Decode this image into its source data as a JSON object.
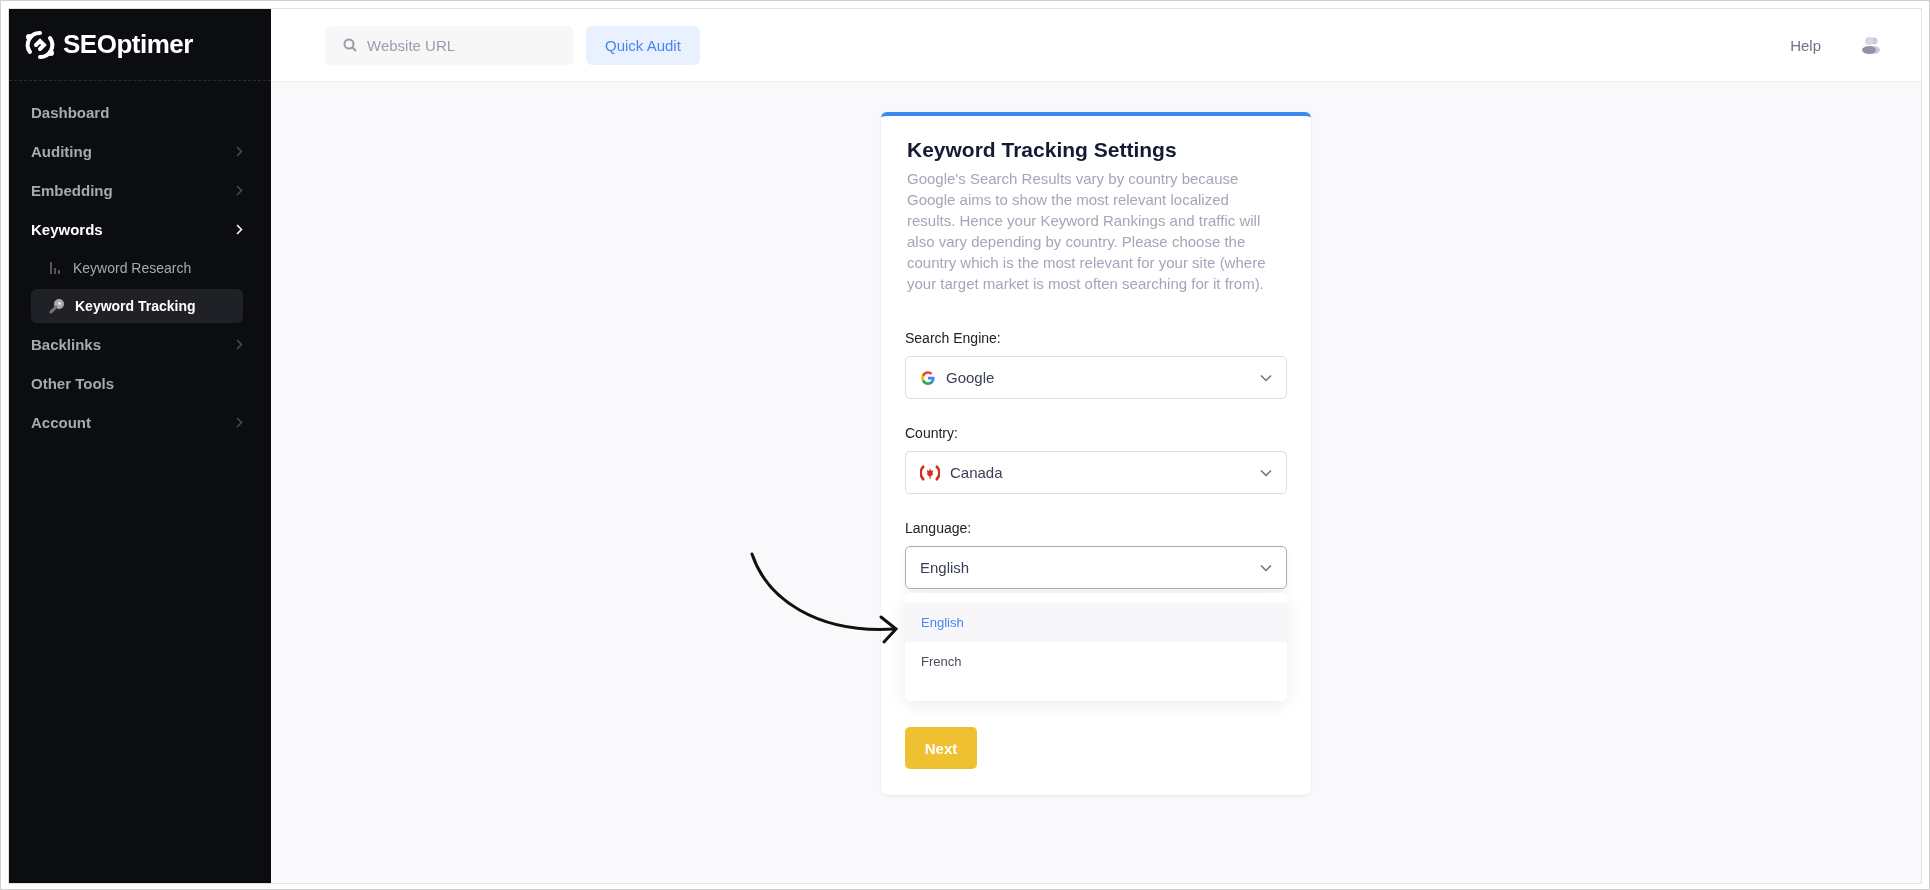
{
  "logo": {
    "text": "SEOptimer"
  },
  "sidebar": {
    "items": [
      {
        "label": "Dashboard",
        "expandable": false,
        "selected": false
      },
      {
        "label": "Auditing",
        "expandable": true,
        "selected": false
      },
      {
        "label": "Embedding",
        "expandable": true,
        "selected": false
      },
      {
        "label": "Keywords",
        "expandable": true,
        "selected": true,
        "children": [
          {
            "label": "Keyword Research",
            "kind": "chart",
            "selected": false
          },
          {
            "label": "Keyword Tracking",
            "kind": "key",
            "selected": true
          }
        ]
      },
      {
        "label": "Backlinks",
        "expandable": true,
        "selected": false
      },
      {
        "label": "Other Tools",
        "expandable": false,
        "selected": false
      },
      {
        "label": "Account",
        "expandable": true,
        "selected": false
      }
    ]
  },
  "topbar": {
    "search": {
      "placeholder": "Website URL"
    },
    "button": "Quick Audit",
    "help": "Help"
  },
  "card": {
    "title": "Keyword Tracking Settings",
    "description": "Google's Search Results vary by country because Google aims to show the most relevant localized results. Hence your Keyword Rankings and traffic will also vary depending by country. Please choose the country which is the most relevant for your site (where your target market is most often searching for it from).",
    "fields": [
      {
        "label": "Search Engine:",
        "value": "Google",
        "kind": "google",
        "open": false
      },
      {
        "label": "Country:",
        "value": "Canada",
        "kind": "canada",
        "open": false
      },
      {
        "label": "Language:",
        "value": "English",
        "open": true,
        "options": [
          {
            "label": "English",
            "selected": true
          },
          {
            "label": "French",
            "selected": false
          }
        ]
      }
    ],
    "button": "Next"
  }
}
